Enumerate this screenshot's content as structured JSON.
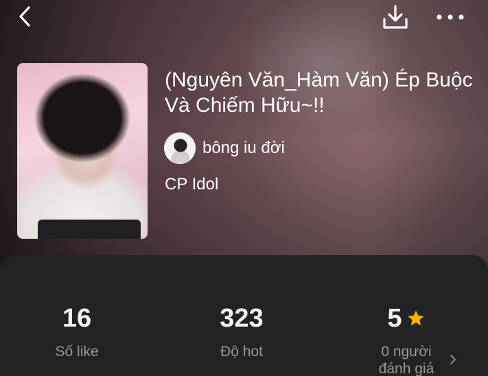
{
  "header": {
    "back_icon": "chevron-left-icon",
    "download_icon": "download-icon",
    "more_icon": "more-horizontal-icon"
  },
  "story": {
    "title": "(Nguyên Văn_Hàm Văn) Ép Buộc Và Chiếm Hữu~!!",
    "author": "bông iu đời",
    "category": "CP Idol"
  },
  "stats": {
    "likes": {
      "value": "16",
      "label": "Số like"
    },
    "hot": {
      "value": "323",
      "label": "Độ hot"
    },
    "rating": {
      "value": "5",
      "label": "0 người đánh giá",
      "star_color": "#f5b400"
    }
  },
  "colors": {
    "panel_bg": "#232323",
    "text_primary": "#ffffff",
    "text_secondary": "#9a9a9a"
  }
}
